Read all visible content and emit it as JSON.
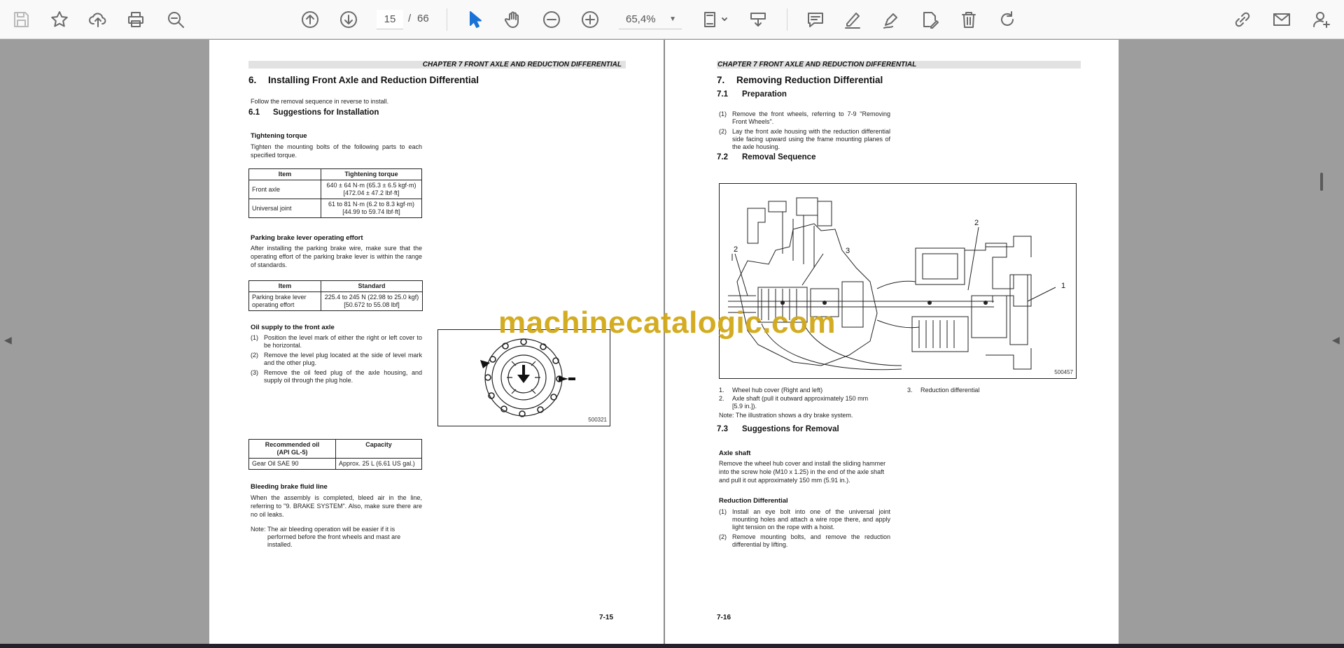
{
  "toolbar": {
    "current_page": "15",
    "page_separator": "/",
    "total_pages": "66",
    "zoom": "65,4%"
  },
  "left_page": {
    "chapter_header": "CHAPTER 7 FRONT AXLE AND REDUCTION DIFFERENTIAL",
    "section_num": "6.",
    "section_title": "Installing Front Axle and Reduction Differential",
    "intro": "Follow the removal sequence in reverse to install.",
    "subsection_num": "6.1",
    "subsection_title": "Suggestions for Installation",
    "torque_heading": "Tightening torque",
    "torque_text": "Tighten the mounting bolts of the following parts to each specified torque.",
    "torque_table": {
      "headers": [
        "Item",
        "Tightening torque"
      ],
      "rows": [
        [
          "Front axle",
          "640 ± 64 N·m (65.3 ± 6.5 kgf·m)",
          "[472.04 ± 47.2 lbf·ft]"
        ],
        [
          "Universal joint",
          "61 to 81 N·m (6.2 to 8.3 kgf·m)",
          "[44.99 to 59.74 lbf·ft]"
        ]
      ]
    },
    "brake_heading": "Parking brake lever operating effort",
    "brake_text": "After installing the parking brake wire, make sure that the operating effort of the parking brake lever is within the range of standards.",
    "brake_table": {
      "headers": [
        "Item",
        "Standard"
      ],
      "row_item_1": "Parking brake lever",
      "row_item_2": "operating effort",
      "row_std_1": "225.4 to 245 N (22.98 to 25.0 kgf)",
      "row_std_2": "[50.672 to 55.08 lbf]"
    },
    "oil_heading": "Oil supply to the front axle",
    "oil_steps": [
      {
        "n": "(1)",
        "t": "Position the level mark of either the right or left cover to be horizontal."
      },
      {
        "n": "(2)",
        "t": "Remove the level plug located at the side of level mark and the other plug."
      },
      {
        "n": "(3)",
        "t": "Remove the oil feed plug of the axle housing, and supply oil through the plug hole."
      }
    ],
    "figure_code": "500321",
    "oil_table": {
      "h1a": "Recommended oil",
      "h1b": "(API GL-5)",
      "h2": "Capacity",
      "r1": "Gear Oil SAE 90",
      "r2": "Approx. 25 L (6.61 US gal.)"
    },
    "bleed_heading": "Bleeding brake fluid line",
    "bleed_text": "When the assembly is completed, bleed air in the line, referring to \"9. BRAKE SYSTEM\". Also, make sure there are no oil leaks.",
    "note_label": "Note:",
    "note_text": "The air bleeding operation will be easier if it is performed before the front wheels and mast are installed.",
    "page_number": "7-15"
  },
  "right_page": {
    "chapter_header": "CHAPTER 7 FRONT AXLE AND REDUCTION DIFFERENTIAL",
    "section_num": "7.",
    "section_title": "Removing Reduction Differential",
    "prep_num": "7.1",
    "prep_title": "Preparation",
    "prep_steps": [
      {
        "n": "(1)",
        "t": "Remove the front wheels, referring to 7-9 \"Removing Front Wheels\"."
      },
      {
        "n": "(2)",
        "t": "Lay the front axle housing with the reduction differential side facing upward using the frame mounting planes of the axle housing."
      }
    ],
    "seq_num": "7.2",
    "seq_title": "Removal Sequence",
    "figure_code": "500457",
    "callouts": [
      "2",
      "3",
      "2",
      "1"
    ],
    "legend": [
      {
        "n": "1.",
        "t": "Wheel hub cover (Right and left)"
      },
      {
        "n": "2.",
        "t": "Axle shaft (pull it outward approximately 150 mm [5.9 in.])."
      },
      {
        "n": "3.",
        "t": "Reduction differential"
      }
    ],
    "illus_note": "Note: The illustration shows a dry brake system.",
    "sugg_num": "7.3",
    "sugg_title": "Suggestions for Removal",
    "axle_heading": "Axle shaft",
    "axle_text": "Remove the wheel hub cover and install the sliding hammer into the screw hole (M10 x 1.25) in the end of the axle shaft and pull it out approximately 150 mm (5.91 in.).",
    "diff_heading": "Reduction Differential",
    "diff_steps": [
      {
        "n": "(1)",
        "t": "Install an eye bolt into one of the universal joint mounting holes and attach a wire rope there, and apply light tension on the rope with a hoist."
      },
      {
        "n": "(2)",
        "t": "Remove mounting bolts, and remove the reduction differential by lifting."
      }
    ],
    "page_number": "7-16"
  },
  "watermark": "machinecatalogic.com"
}
